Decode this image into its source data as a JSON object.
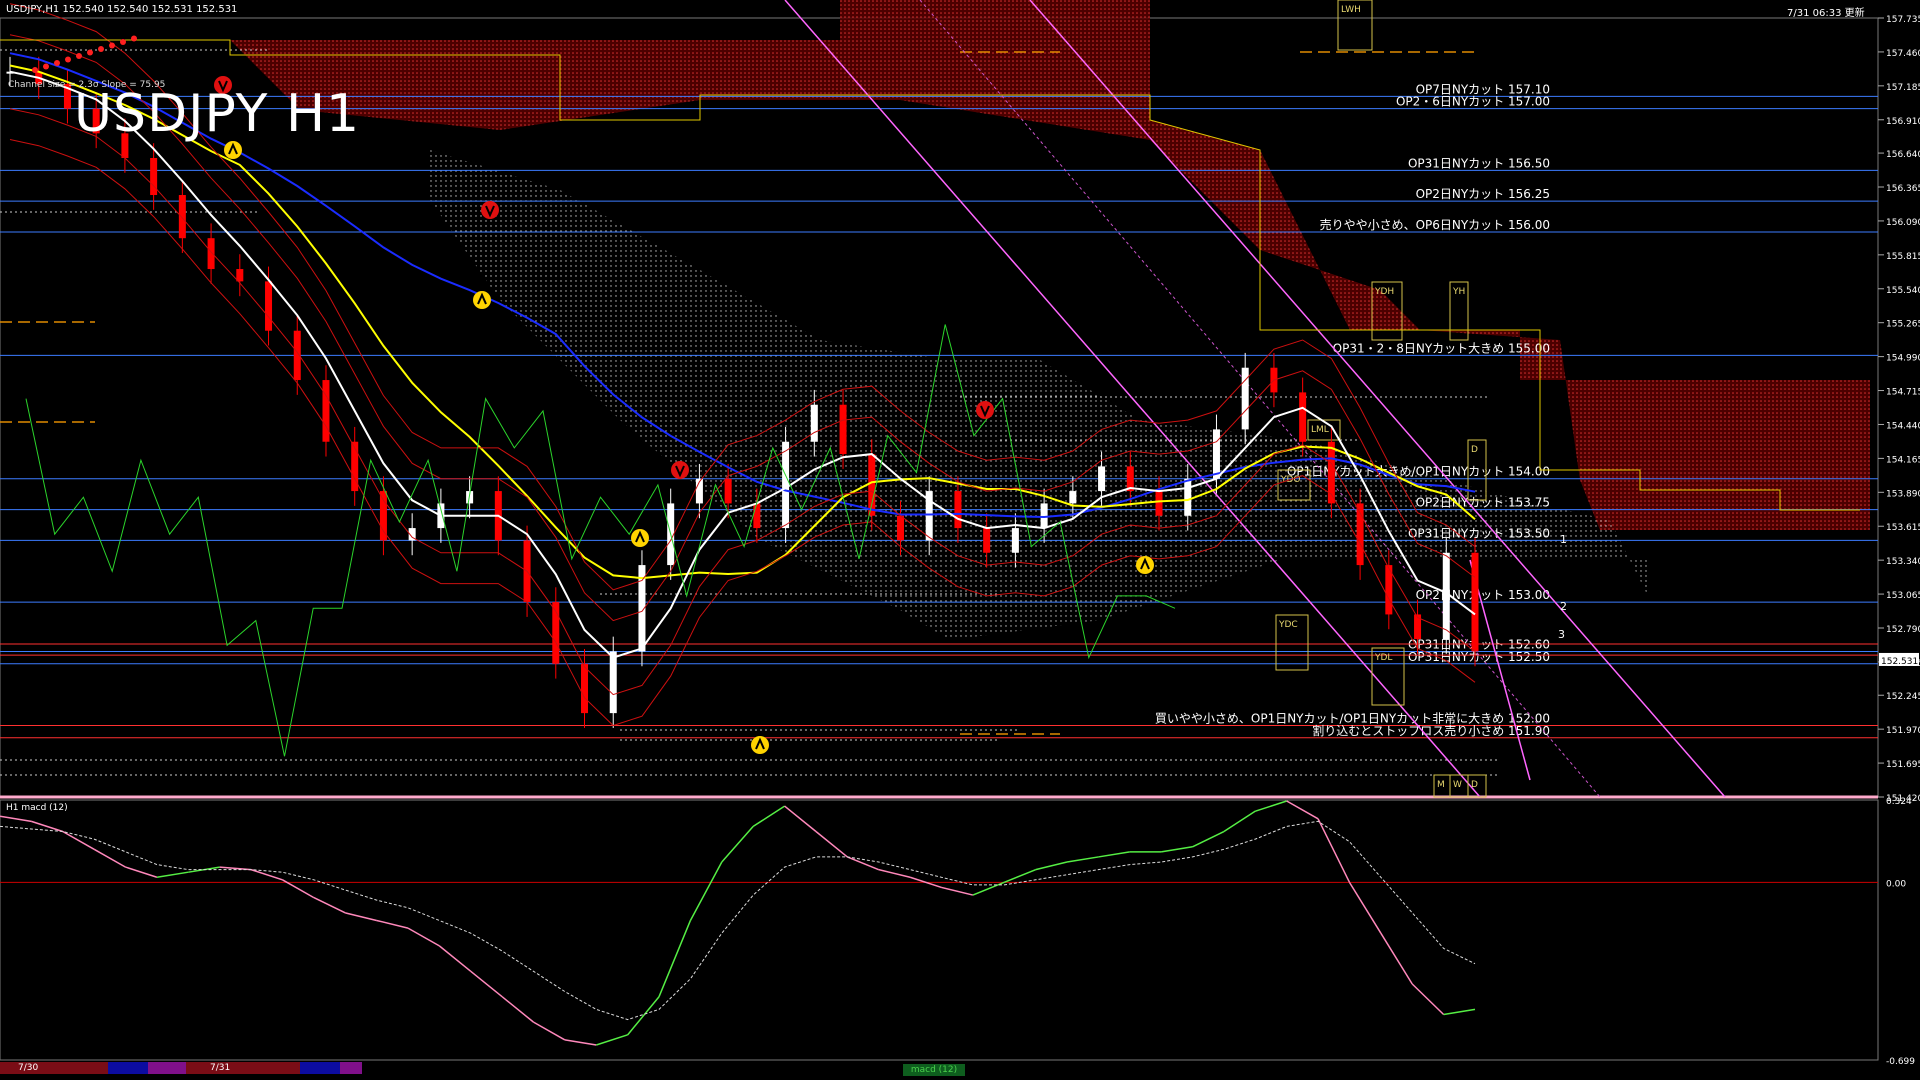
{
  "window": {
    "symbol_line": "USDJPY,H1  152.540 152.540 152.531 152.531",
    "timestamp": "7/31 06:33 更新",
    "title": "USDJPY H1",
    "channel_info": "Channel size = 2.3σ Slope = 75.95"
  },
  "macd_label": "H1 macd (12)",
  "bottom_bar": {
    "date_1": "7/30",
    "date_2": "7/31",
    "tab_label": "macd (12)"
  },
  "colors": {
    "background": "#000000",
    "bull_candle": "#ffffff",
    "bear_candle": "#ff0000",
    "kumo": "#ff2a2a",
    "ma_white": "#ffffff",
    "ma_yellow": "#ffff00",
    "ma_blue": "#1a2cff",
    "option_line": "#3c7cff",
    "channel_magenta": "#ff66ff",
    "chikou_green": "#2bd42b",
    "macd_green": "#55ee44",
    "macd_pink": "#ff88bb"
  },
  "chart_data": [
    {
      "type": "line",
      "title": "USDJPY H1",
      "ylim": [
        151.42,
        157.735
      ],
      "y_ticks": [
        "157.735",
        "157.460",
        "157.185",
        "156.910",
        "156.640",
        "156.365",
        "156.090",
        "155.815",
        "155.540",
        "155.265",
        "154.990",
        "154.715",
        "154.440",
        "154.165",
        "153.890",
        "153.615",
        "153.340",
        "153.065",
        "152.790",
        "152.515",
        "152.245",
        "151.970",
        "151.695",
        "151.420"
      ],
      "current_price": "152.531",
      "close_series": [
        157.3,
        157.2,
        157.0,
        156.8,
        156.6,
        156.3,
        155.95,
        155.7,
        155.6,
        155.2,
        154.8,
        154.3,
        153.9,
        153.5,
        153.6,
        153.8,
        153.9,
        153.5,
        153.0,
        152.5,
        152.1,
        152.6,
        153.3,
        153.8,
        154.0,
        153.8,
        153.6,
        154.3,
        154.6,
        154.2,
        153.7,
        153.5,
        153.9,
        153.6,
        153.4,
        153.6,
        153.8,
        153.9,
        154.1,
        153.9,
        153.7,
        154.0,
        154.4,
        154.9,
        154.7,
        154.3,
        153.8,
        153.3,
        152.9,
        152.7,
        153.4,
        152.6
      ],
      "option_levels": [
        {
          "label": "OP7日NYカット 157.10",
          "price": 157.1
        },
        {
          "label": "OP2・6日NYカット 157.00",
          "price": 157.0
        },
        {
          "label": "OP31日NYカット 156.50",
          "price": 156.5
        },
        {
          "label": "OP2日NYカット 156.25",
          "price": 156.25
        },
        {
          "label": "売りやや小さめ、OP6日NYカット 156.00",
          "price": 156.0
        },
        {
          "label": "OP31・2・8日NYカット大きめ 155.00",
          "price": 155.0
        },
        {
          "label": "OP1日NYカット大きめ/OP1日NYカット 154.00",
          "price": 154.0
        },
        {
          "label": "OP2日NYカット 153.75",
          "price": 153.75
        },
        {
          "label": "OP31日NYカット 153.50",
          "price": 153.5
        },
        {
          "label": "OP2日NYカット 153.00",
          "price": 153.0
        },
        {
          "label": "OP31日NYカット 152.60",
          "price": 152.6
        },
        {
          "label": "OP31日NYカット 152.50",
          "price": 152.5
        }
      ],
      "red_levels": [
        {
          "label": "買いやや小さめ、OP1日NYカット/OP1日NYカット非常に大きめ 152.00",
          "price": 152.0
        },
        {
          "label": "割り込むとストップロス売り小さめ 151.90",
          "price": 151.9
        }
      ],
      "box_labels": [
        "LWH",
        "YDH",
        "YH",
        "YDO",
        "YDC",
        "YDL",
        "LML",
        "D",
        "M",
        "W"
      ],
      "channel_labels": [
        "1",
        "2",
        "3"
      ]
    },
    {
      "type": "line",
      "title": "H1 macd (12)",
      "ylim": [
        -0.699,
        0.324
      ],
      "y_ticks": [
        "0.324",
        "0.00",
        "-0.699"
      ],
      "macd": [
        0.26,
        0.24,
        0.2,
        0.13,
        0.06,
        0.02,
        0.04,
        0.06,
        0.05,
        0.01,
        -0.06,
        -0.12,
        -0.15,
        -0.18,
        -0.25,
        -0.35,
        -0.45,
        -0.55,
        -0.62,
        -0.64,
        -0.6,
        -0.45,
        -0.15,
        0.08,
        0.22,
        0.3,
        0.2,
        0.1,
        0.05,
        0.02,
        -0.02,
        -0.05,
        0.0,
        0.05,
        0.08,
        0.1,
        0.12,
        0.12,
        0.14,
        0.2,
        0.28,
        0.32,
        0.25,
        0.0,
        -0.2,
        -0.4,
        -0.52,
        -0.5
      ],
      "signal": [
        0.22,
        0.21,
        0.2,
        0.17,
        0.12,
        0.07,
        0.05,
        0.05,
        0.05,
        0.04,
        0.01,
        -0.03,
        -0.07,
        -0.1,
        -0.15,
        -0.2,
        -0.27,
        -0.35,
        -0.43,
        -0.5,
        -0.54,
        -0.5,
        -0.38,
        -0.2,
        -0.05,
        0.06,
        0.1,
        0.1,
        0.08,
        0.05,
        0.02,
        -0.01,
        -0.01,
        0.01,
        0.03,
        0.05,
        0.07,
        0.08,
        0.1,
        0.13,
        0.17,
        0.22,
        0.24,
        0.16,
        0.02,
        -0.12,
        -0.26,
        -0.32
      ]
    }
  ]
}
